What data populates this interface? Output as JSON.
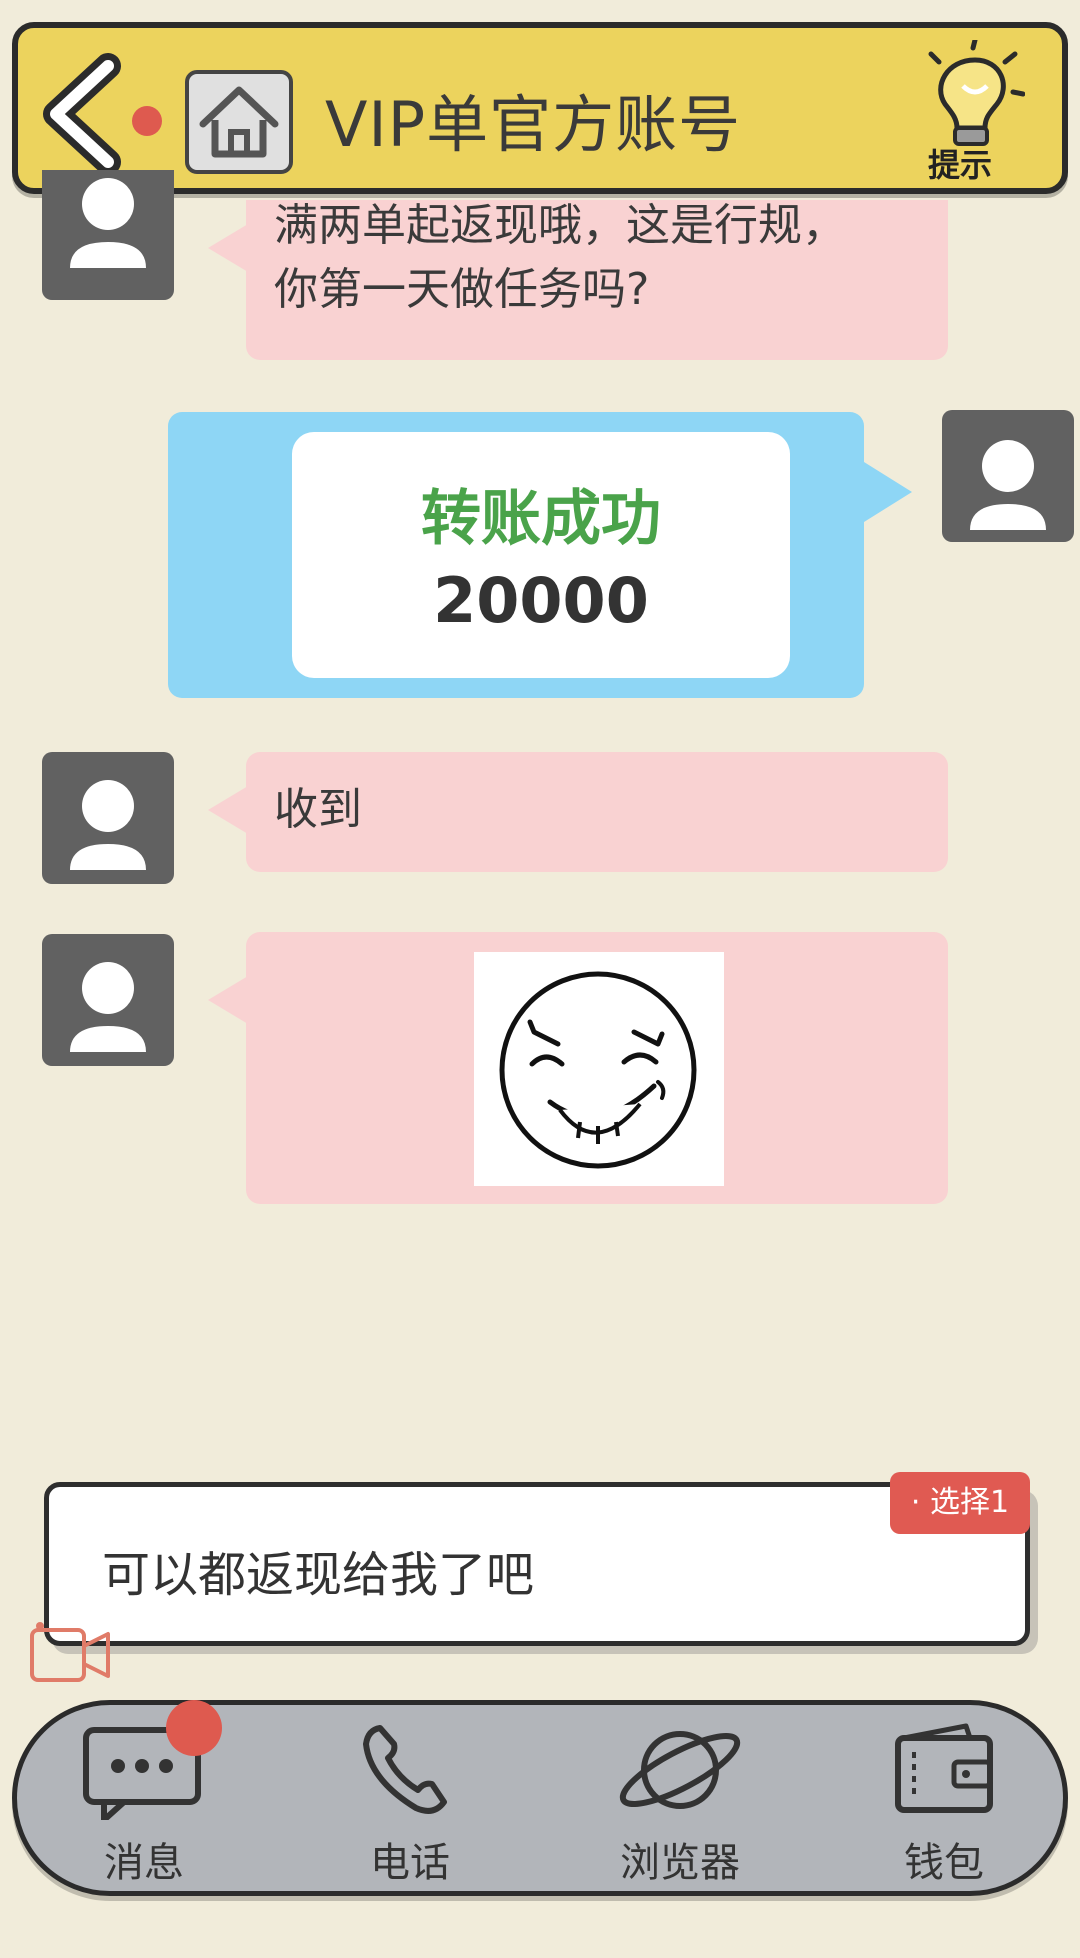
{
  "header": {
    "title": "VIP单官方账号",
    "hint_label": "提示"
  },
  "messages": [
    {
      "side": "left",
      "text_lines": [
        "满两单起返现哦，这是行规，",
        "你第一天做任务吗?"
      ]
    },
    {
      "side": "right",
      "type": "transfer",
      "title": "转账成功",
      "amount": "20000"
    },
    {
      "side": "left",
      "text": "收到"
    },
    {
      "side": "left",
      "type": "sticker",
      "sticker": "smirk-face"
    }
  ],
  "choice": {
    "text": "可以都返现给我了吧",
    "badge": "· 选择1"
  },
  "nav": {
    "items": [
      {
        "label": "消息",
        "icon": "chat-icon"
      },
      {
        "label": "电话",
        "icon": "phone-icon"
      },
      {
        "label": "浏览器",
        "icon": "planet-icon"
      },
      {
        "label": "钱包",
        "icon": "wallet-icon"
      }
    ]
  },
  "colors": {
    "header": "#ecd35d",
    "background": "#f1ecda",
    "bubble_incoming": "#f9d2d2",
    "bubble_outgoing": "#8ed6f5",
    "transfer_title": "#4aa34a",
    "badge": "#e05a52",
    "nav": "#b2b5ba"
  }
}
